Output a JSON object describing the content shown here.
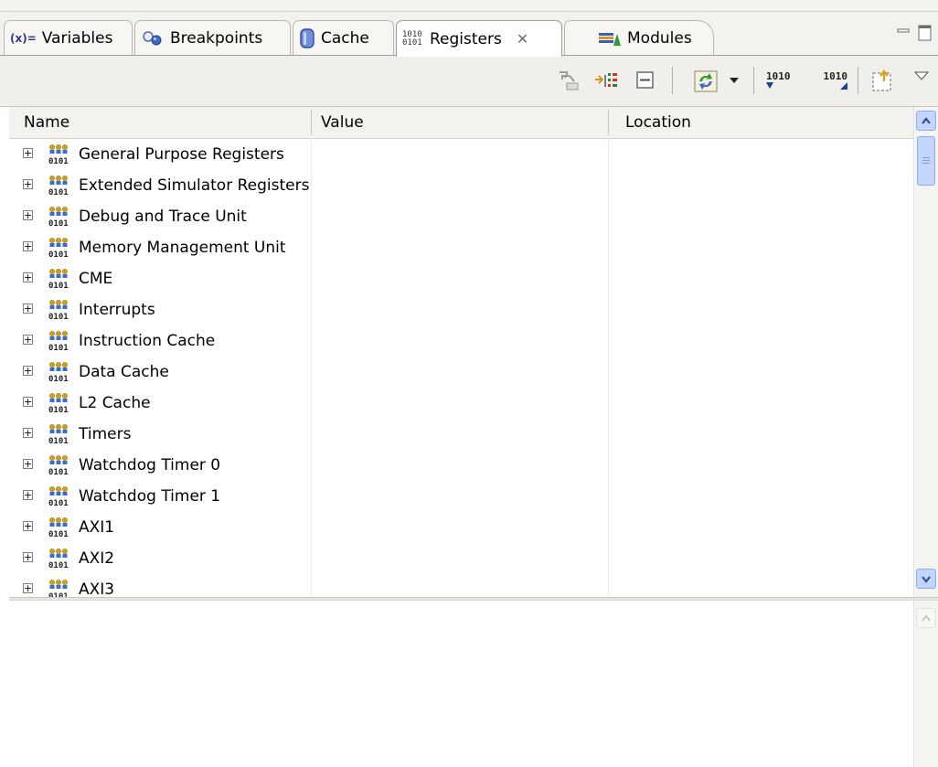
{
  "tabs": [
    {
      "label": "Variables",
      "icon": "variables-icon",
      "active": false
    },
    {
      "label": "Breakpoints",
      "icon": "breakpoints-icon",
      "active": false
    },
    {
      "label": "Cache",
      "icon": "cache-icon",
      "active": false
    },
    {
      "label": "Registers",
      "icon": "registers-icon",
      "active": true
    },
    {
      "label": "Modules",
      "icon": "modules-icon",
      "active": false
    }
  ],
  "tab_icon_text": {
    "variables": "(x)=",
    "registers": "1010 0101"
  },
  "close_glyph": "✕",
  "window_controls": [
    "minimize-icon",
    "maximize-icon"
  ],
  "toolbar": {
    "items": [
      "type-register-icon",
      "add-register-group-icon",
      "collapse-all-icon",
      "refresh-icon",
      "dropdown-arrow-icon",
      "number-format-icon",
      "number-format-2-icon",
      "export-icon",
      "view-menu-icon"
    ],
    "format_text_1": "1010",
    "format_text_2": "1010"
  },
  "columns": [
    "Name",
    "Value",
    "Location"
  ],
  "rows": [
    "General Purpose Registers",
    "Extended Simulator Registers",
    "Debug and Trace Unit",
    "Memory Management Unit",
    "CME",
    "Interrupts",
    "Instruction Cache",
    "Data Cache",
    "L2 Cache",
    "Timers",
    "Watchdog Timer 0",
    "Watchdog Timer 1",
    "AXI1",
    "AXI2",
    "AXI3"
  ],
  "expand_glyph": "+",
  "colors": {
    "scroll_active": "#c4d5fb",
    "scroll_border": "#8eaaf0",
    "tab_border": "#9f9c92"
  }
}
